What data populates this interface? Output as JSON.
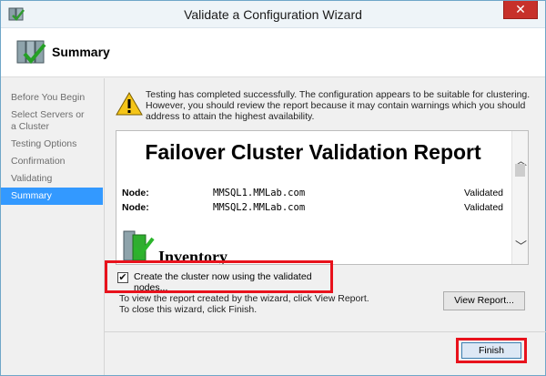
{
  "window": {
    "title": "Validate a Configuration Wizard",
    "close_glyph": "✕"
  },
  "header": {
    "title": "Summary"
  },
  "nav": {
    "items": [
      {
        "label": "Before You Begin",
        "active": false
      },
      {
        "label": "Select Servers or a Cluster",
        "active": false
      },
      {
        "label": "Testing Options",
        "active": false
      },
      {
        "label": "Confirmation",
        "active": false
      },
      {
        "label": "Validating",
        "active": false
      },
      {
        "label": "Summary",
        "active": true
      }
    ]
  },
  "status": {
    "icon": "warning-icon",
    "text": "Testing has completed successfully. The configuration appears to be suitable for clustering. However, you should review the report because it may contain warnings which you should address to attain the highest availability."
  },
  "report": {
    "title": "Failover Cluster Validation Report",
    "nodes": [
      {
        "label": "Node:",
        "name": "MMSQL1.MMLab.com",
        "status": "Validated"
      },
      {
        "label": "Node:",
        "name": "MMSQL2.MMLab.com",
        "status": "Validated"
      }
    ],
    "section_heading": "Inventory"
  },
  "create_cluster": {
    "label": "Create the cluster now using the validated nodes...",
    "checked": true,
    "check_glyph": "✔"
  },
  "hints": {
    "view_report": "To view the report created by the wizard, click View Report.",
    "close_wizard": "To close this wizard, click Finish."
  },
  "buttons": {
    "view_report": "View Report...",
    "finish": "Finish"
  },
  "colors": {
    "active_nav": "#3399ff",
    "highlight_border": "#e8121c",
    "close_button": "#c7312a"
  }
}
